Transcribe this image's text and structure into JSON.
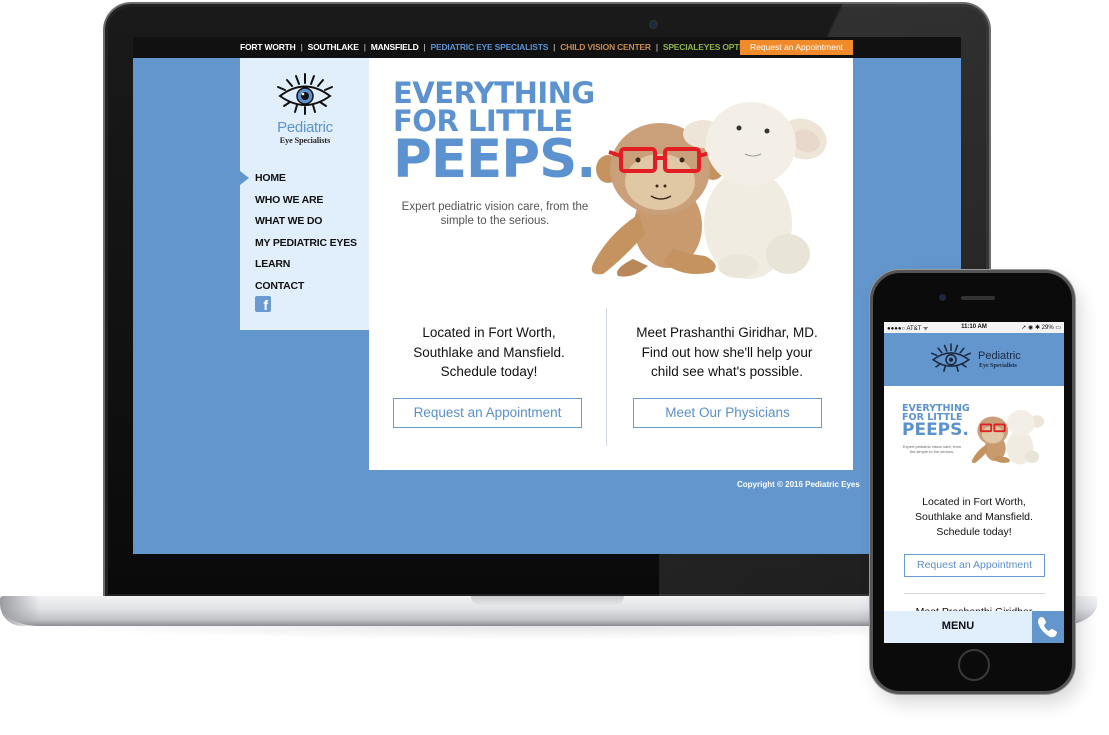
{
  "topbar": {
    "links": [
      {
        "label": "FORT WORTH",
        "color": "#ffffff"
      },
      {
        "label": "SOUTHLAKE",
        "color": "#ffffff"
      },
      {
        "label": "MANSFIELD",
        "color": "#ffffff"
      },
      {
        "label": "PEDIATRIC EYE SPECIALISTS",
        "color": "#5b92cf"
      },
      {
        "label": "CHILD VISION CENTER",
        "color": "#c58a4e"
      },
      {
        "label": "SPECIALEYES OPTICAL",
        "color": "#8fb24a"
      }
    ],
    "separator": "|",
    "appointment_button": "Request an Appointment",
    "appointment_color": "#f08a2a"
  },
  "logo": {
    "name": "Pediatric",
    "tagline": "Eye Specialists"
  },
  "nav": {
    "items": [
      {
        "label": "HOME",
        "active": true
      },
      {
        "label": "WHO WE ARE"
      },
      {
        "label": "WHAT WE DO"
      },
      {
        "label": "MY PEDIATRIC EYES"
      },
      {
        "label": "LEARN"
      },
      {
        "label": "CONTACT"
      }
    ],
    "social_icon": "f"
  },
  "hero": {
    "line1": "EVERYTHING",
    "line2": "FOR LITTLE",
    "line3": "PEEPS.",
    "subtitle": "Expert pediatric vision care, from the simple to the serious."
  },
  "columns": {
    "left": {
      "lines": [
        "Located in Fort Worth,",
        "Southlake and Mansfield.",
        "Schedule today!"
      ],
      "button": "Request an Appointment"
    },
    "right": {
      "lines": [
        "Meet Prashanthi Giridhar, MD.",
        "Find out how she'll help your",
        "child see what's possible."
      ],
      "button": "Meet Our Physicians"
    }
  },
  "footer": {
    "copyright": "Copyright © 2016 Pediatric Eyes"
  },
  "mobile": {
    "status": {
      "carrier": "●●●●○ AT&T ᯤ",
      "time": "11:10 AM",
      "battery": "➚ ◉ ✱ 29% ▭"
    },
    "logo_name": "Pediatric",
    "logo_tagline": "Eye Specialists",
    "hero": {
      "line1": "EVERYTHING",
      "line2": "FOR LITTLE",
      "line3": "PEEPS.",
      "subtitle": "Expert pediatric vision care, from the simple to the serious."
    },
    "text_lines": [
      "Located in Fort Worth,",
      "Southlake and Mansfield.",
      "Schedule today!"
    ],
    "button": "Request an Appointment",
    "next_text": "Meet Prashanthi Giridhar",
    "menu_label": "MENU"
  },
  "colors": {
    "brand_blue": "#6396cc",
    "light_blue": "#e1eefb",
    "accent_orange": "#f08a2a"
  }
}
